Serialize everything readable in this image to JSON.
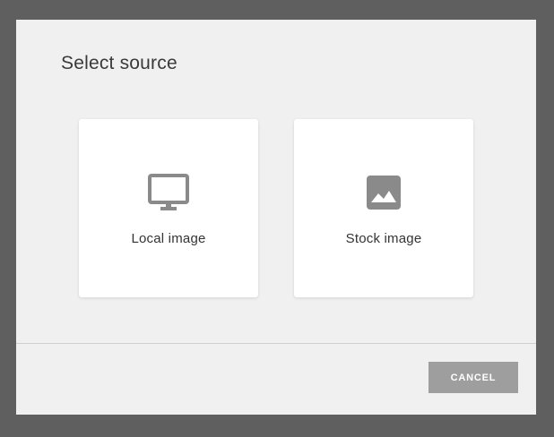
{
  "dialog": {
    "title": "Select source",
    "sources": [
      {
        "label": "Local image",
        "icon": "monitor-icon"
      },
      {
        "label": "Stock image",
        "icon": "image-icon"
      }
    ],
    "cancel_label": "CANCEL"
  },
  "colors": {
    "backdrop": "#5f5f5f",
    "dialog_bg": "#f0f0f0",
    "card_bg": "#ffffff",
    "icon": "#8a8a8a",
    "button_bg": "#9e9e9e"
  }
}
